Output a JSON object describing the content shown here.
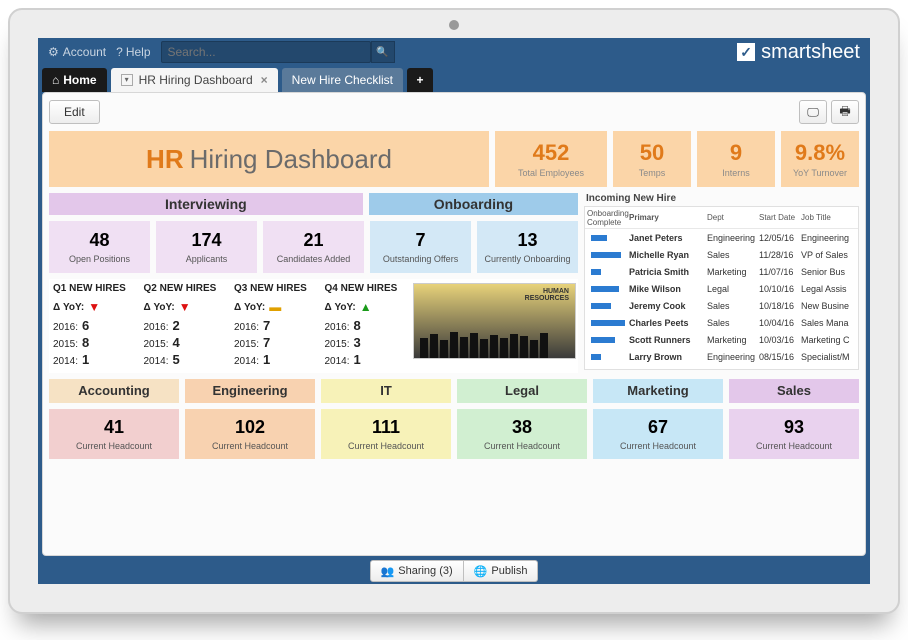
{
  "topbar": {
    "account": "Account",
    "help": "Help",
    "search_placeholder": "Search..."
  },
  "brand": "smartsheet",
  "tabs": {
    "home": "Home",
    "t1": "HR Hiring Dashboard",
    "t2": "New Hire Checklist"
  },
  "toolbar": {
    "edit": "Edit"
  },
  "title": {
    "p1": "HR",
    "p2": "Hiring Dashboard"
  },
  "metrics": {
    "employees": {
      "v": "452",
      "l": "Total Employees"
    },
    "temps": {
      "v": "50",
      "l": "Temps"
    },
    "interns": {
      "v": "9",
      "l": "Interns"
    },
    "turnover": {
      "v": "9.8%",
      "l": "YoY Turnover"
    }
  },
  "sections": {
    "interviewing": "Interviewing",
    "onboarding": "Onboarding"
  },
  "cards": {
    "open_positions": {
      "v": "48",
      "l": "Open Positions"
    },
    "applicants": {
      "v": "174",
      "l": "Applicants"
    },
    "candidates_added": {
      "v": "21",
      "l": "Candidates Added"
    },
    "outstanding_offers": {
      "v": "7",
      "l": "Outstanding Offers"
    },
    "currently_onboarding": {
      "v": "13",
      "l": "Currently Onboarding"
    }
  },
  "quarters": {
    "dyoy_label": "Δ YoY:",
    "y2016": "2016:",
    "y2015": "2015:",
    "y2014": "2014:",
    "q1": {
      "h": "Q1 NEW HIRES",
      "v2016": "6",
      "v2015": "8",
      "v2014": "1"
    },
    "q2": {
      "h": "Q2 NEW HIRES",
      "v2016": "2",
      "v2015": "4",
      "v2014": "5"
    },
    "q3": {
      "h": "Q3 NEW HIRES",
      "v2016": "7",
      "v2015": "7",
      "v2014": "1"
    },
    "q4": {
      "h": "Q4 NEW HIRES",
      "v2016": "8",
      "v2015": "3",
      "v2014": "1"
    }
  },
  "table": {
    "title": "Incoming New Hire",
    "h_ob": "Onboarding Complete",
    "h_pr": "Primary",
    "h_dp": "Dept",
    "h_sd": "Start Date",
    "h_jt": "Job Title",
    "rows": [
      {
        "pr": "Janet Peters",
        "dp": "Engineering",
        "sd": "12/05/16",
        "jt": "Engineering"
      },
      {
        "pr": "Michelle Ryan",
        "dp": "Sales",
        "sd": "11/28/16",
        "jt": "VP of Sales"
      },
      {
        "pr": "Patricia Smith",
        "dp": "Marketing",
        "sd": "11/07/16",
        "jt": "Senior Bus"
      },
      {
        "pr": "Mike Wilson",
        "dp": "Legal",
        "sd": "10/10/16",
        "jt": "Legal Assis"
      },
      {
        "pr": "Jeremy Cook",
        "dp": "Sales",
        "sd": "10/18/16",
        "jt": "New Busine"
      },
      {
        "pr": "Charles Peets",
        "dp": "Sales",
        "sd": "10/04/16",
        "jt": "Sales Mana"
      },
      {
        "pr": "Scott Runners",
        "dp": "Marketing",
        "sd": "10/03/16",
        "jt": "Marketing C"
      },
      {
        "pr": "Larry Brown",
        "dp": "Engineering",
        "sd": "08/15/16",
        "jt": "Specialist/M"
      }
    ]
  },
  "departments": {
    "d0": {
      "name": "Accounting",
      "hc": "41"
    },
    "d1": {
      "name": "Engineering",
      "hc": "102"
    },
    "d2": {
      "name": "IT",
      "hc": "111"
    },
    "d3": {
      "name": "Legal",
      "hc": "38"
    },
    "d4": {
      "name": "Marketing",
      "hc": "67"
    },
    "d5": {
      "name": "Sales",
      "hc": "93"
    },
    "hc_label": "Current Headcount"
  },
  "bottombar": {
    "sharing": "Sharing (3)",
    "publish": "Publish"
  }
}
